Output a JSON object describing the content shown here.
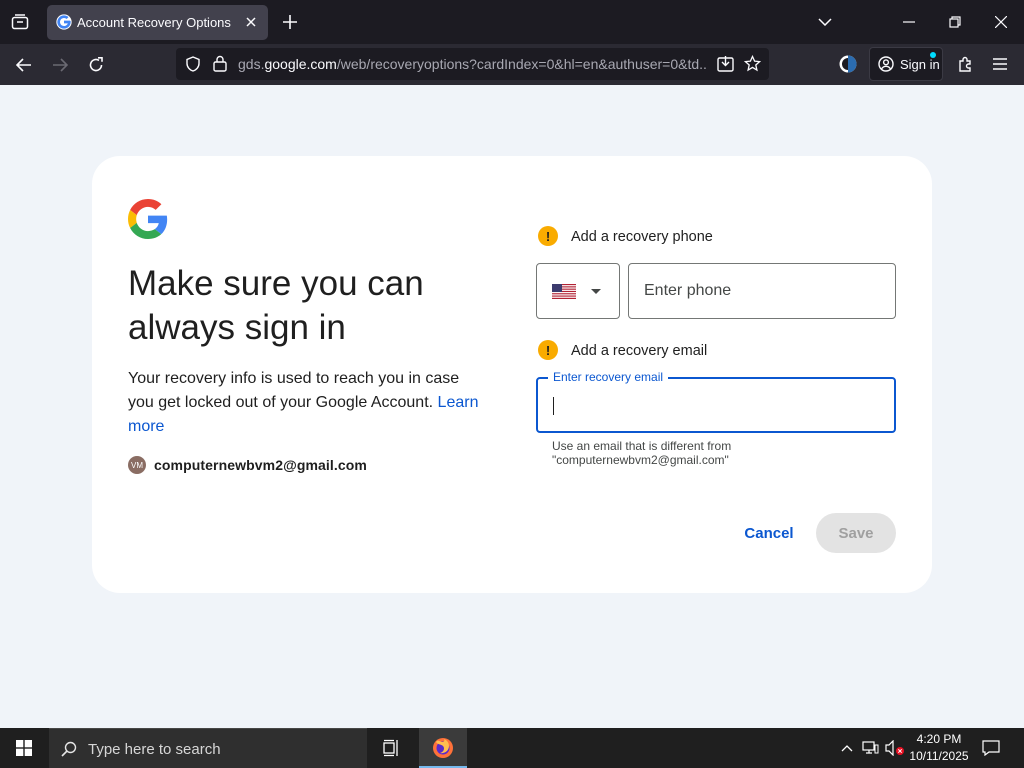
{
  "browser": {
    "tab_title": "Account Recovery Options",
    "url_host": "gds.google.com",
    "url_path": "/web/recoveryoptions?cardIndex=0&hl=en&authuser=0&td...",
    "url_scheme_prefix": "gds.",
    "url_host_main": "google.com",
    "signin_label": "Sign in"
  },
  "page": {
    "title": "Make sure you can always sign in",
    "description": "Your recovery info is used to reach you in case you get locked out of your Google Account.",
    "learn_more": "Learn more",
    "avatar_initials": "VM",
    "account_email": "computernewbvm2@gmail.com"
  },
  "recovery_phone": {
    "label": "Add a recovery phone",
    "warning_glyph": "!",
    "country": "US",
    "placeholder": "Enter phone"
  },
  "recovery_email": {
    "label": "Add a recovery email",
    "warning_glyph": "!",
    "floating_label": "Enter recovery email",
    "value": "",
    "helper_line1": "Use an email that is different from",
    "helper_line2": "\"computernewbvm2@gmail.com\""
  },
  "actions": {
    "cancel_label": "Cancel",
    "save_label": "Save"
  },
  "taskbar": {
    "search_placeholder": "Type here to search",
    "time": "4:20 PM",
    "date": "10/11/2025"
  },
  "colors": {
    "accent": "#0b57d0",
    "warning": "#f9ab00",
    "page_bg": "#f0f4f9"
  }
}
